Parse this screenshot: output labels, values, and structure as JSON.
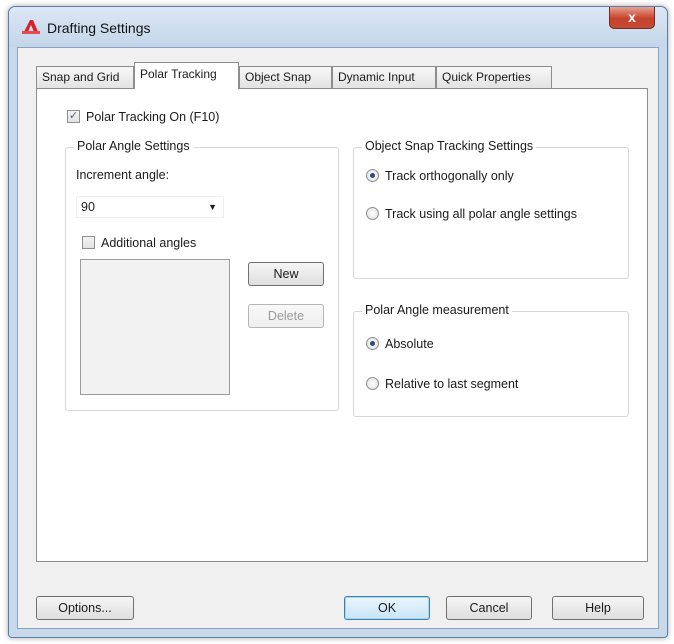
{
  "window": {
    "title": "Drafting Settings",
    "close_glyph": "x"
  },
  "icons": {
    "app": "autocad-icon",
    "close": "close-icon",
    "dropdown": "chevron-down-icon"
  },
  "tabs": [
    {
      "label": "Snap and Grid"
    },
    {
      "label": "Polar Tracking"
    },
    {
      "label": "Object Snap"
    },
    {
      "label": "Dynamic Input"
    },
    {
      "label": "Quick Properties"
    }
  ],
  "polar_tracking": {
    "enabled_label": "Polar Tracking On (F10)",
    "enabled": true,
    "angle_settings": {
      "title": "Polar Angle Settings",
      "increment_label": "Increment angle:",
      "increment_value": "90",
      "additional_label": "Additional angles",
      "additional_checked": false,
      "new_label": "New",
      "delete_label": "Delete"
    },
    "osnap_tracking": {
      "title": "Object Snap Tracking Settings",
      "option1": "Track orthogonally only",
      "option2": "Track using all polar angle settings",
      "selected": "option1"
    },
    "measurement": {
      "title": "Polar Angle measurement",
      "option1": "Absolute",
      "option2": "Relative to last segment",
      "selected": "option1"
    }
  },
  "footer": {
    "options": "Options...",
    "ok": "OK",
    "cancel": "Cancel",
    "help": "Help"
  }
}
